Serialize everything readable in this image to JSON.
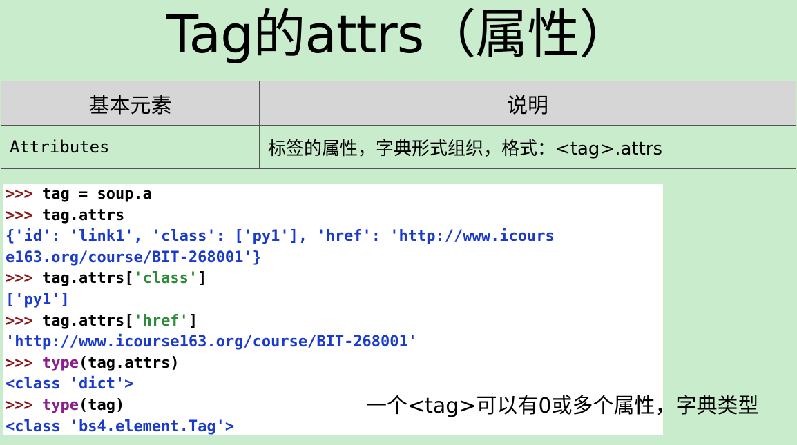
{
  "slide": {
    "title": "Tag的attrs（属性）",
    "table": {
      "headers": [
        "基本元素",
        "说明"
      ],
      "rows": [
        {
          "element": "Attributes",
          "description": "标签的属性，字典形式组织，格式：<tag>.attrs"
        }
      ]
    },
    "code_lines": [
      [
        {
          "c": "p",
          "t": ">>> "
        },
        {
          "c": "k",
          "t": "tag = soup.a"
        }
      ],
      [
        {
          "c": "p",
          "t": ">>> "
        },
        {
          "c": "k",
          "t": "tag.attrs"
        }
      ],
      [
        {
          "c": "b",
          "t": "{'id': 'link1', 'class': ['py1'], 'href': 'http://www.icours"
        }
      ],
      [
        {
          "c": "b",
          "t": "e163.org/course/BIT-268001'}"
        }
      ],
      [
        {
          "c": "p",
          "t": ">>> "
        },
        {
          "c": "k",
          "t": "tag.attrs["
        },
        {
          "c": "g",
          "t": "'class'"
        },
        {
          "c": "k",
          "t": "]"
        }
      ],
      [
        {
          "c": "b",
          "t": "['py1']"
        }
      ],
      [
        {
          "c": "p",
          "t": ">>> "
        },
        {
          "c": "k",
          "t": "tag.attrs["
        },
        {
          "c": "g",
          "t": "'href'"
        },
        {
          "c": "k",
          "t": "]"
        }
      ],
      [
        {
          "c": "b",
          "t": "'http://www.icourse163.org/course/BIT-268001'"
        }
      ],
      [
        {
          "c": "p",
          "t": ">>> "
        },
        {
          "c": "m",
          "t": "type"
        },
        {
          "c": "k",
          "t": "(tag.attrs)"
        }
      ],
      [
        {
          "c": "b",
          "t": "<class 'dict'>"
        }
      ],
      [
        {
          "c": "p",
          "t": ">>> "
        },
        {
          "c": "m",
          "t": "type"
        },
        {
          "c": "k",
          "t": "(tag)"
        }
      ],
      [
        {
          "c": "b",
          "t": "<class 'bs4.element.Tag'>"
        }
      ]
    ],
    "note": "一个<tag>可以有0或多个属性，字典类型"
  },
  "colors": {
    "background": "#c8eccc",
    "header_row": "#d6d6d6",
    "code_background": "#ffffff",
    "prompt": "#8b1a1a",
    "output_blue": "#1a3acc",
    "string_green": "#2e8b3a",
    "builtin_purple": "#8a1f8a"
  }
}
